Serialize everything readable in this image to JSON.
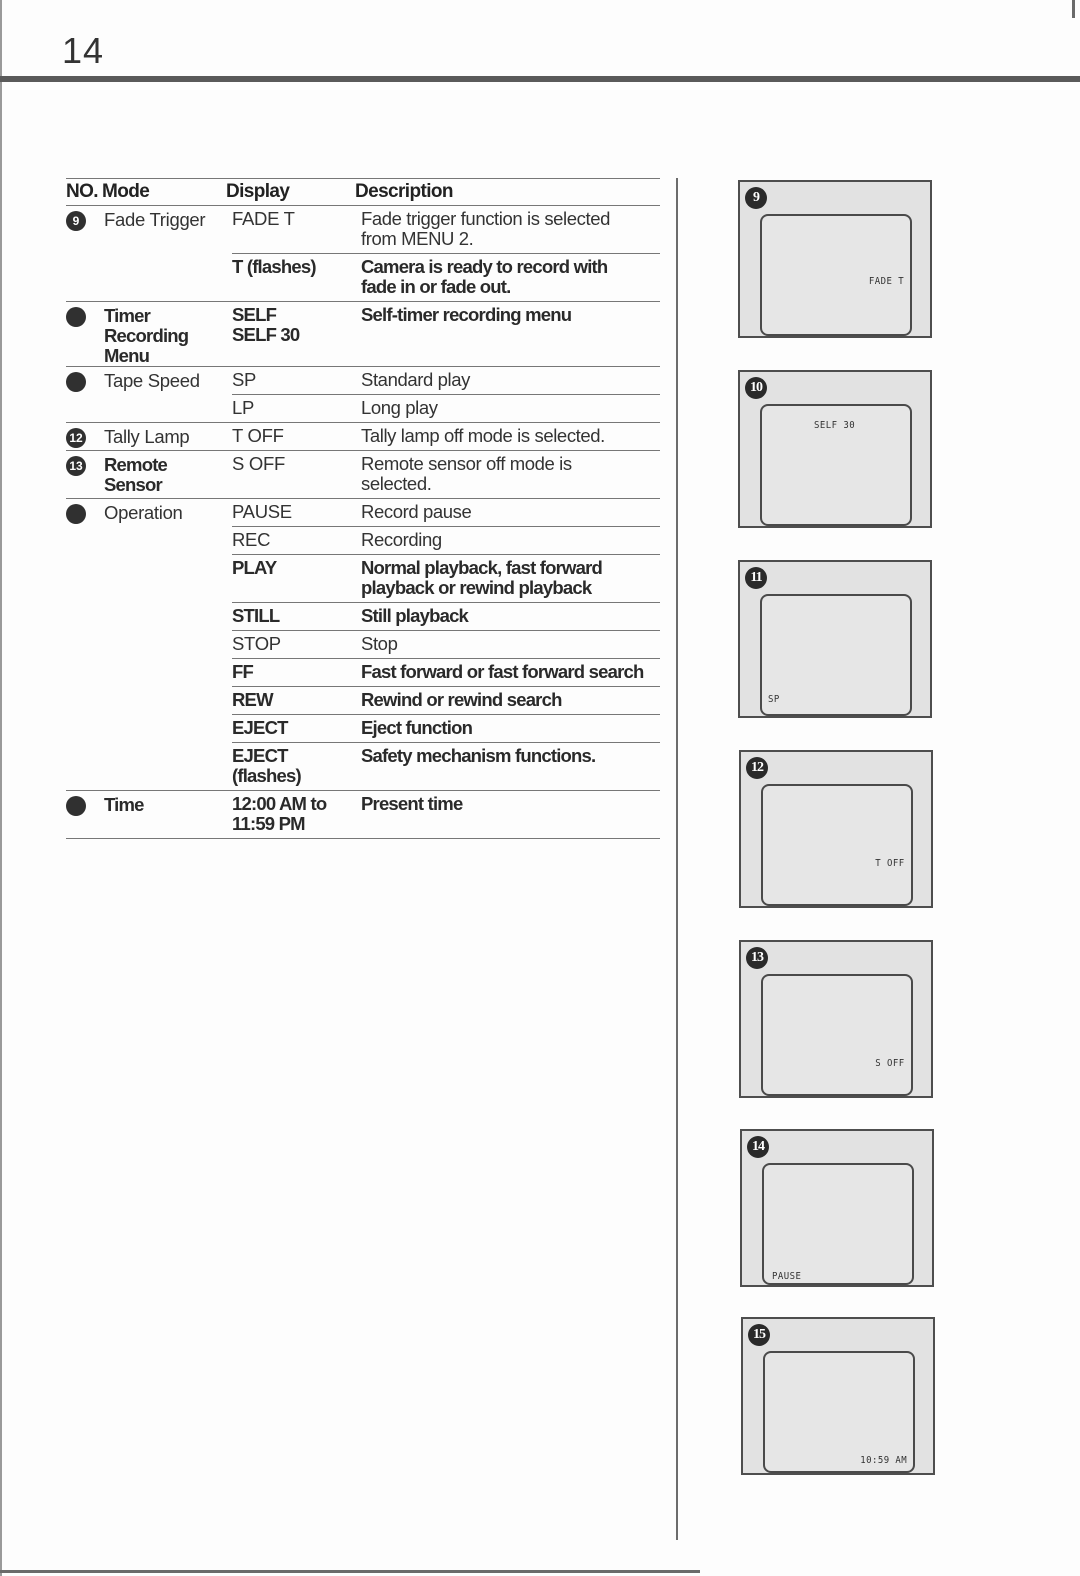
{
  "page": {
    "number": "14"
  },
  "table": {
    "headers": {
      "no": "NO.",
      "mode": "Mode",
      "display": "Display",
      "description": "Description"
    },
    "groups": [
      {
        "marker": "9",
        "mode": "Fade Trigger",
        "rows": [
          {
            "display": "FADE T",
            "description": "Fade trigger function is selected\nfrom MENU 2.",
            "bold": false
          },
          {
            "display": "T (flashes)",
            "description": "Camera is ready to record with\nfade in or fade out.",
            "bold": true
          }
        ]
      },
      {
        "marker": "",
        "mode": "Timer\nRecording\nMenu",
        "rows": [
          {
            "display": "SELF\nSELF 30",
            "description": "Self-timer recording menu",
            "bold": true
          }
        ]
      },
      {
        "marker": "",
        "mode": "Tape Speed",
        "rows": [
          {
            "display": "SP",
            "description": "Standard play",
            "bold": false
          },
          {
            "display": "LP",
            "description": "Long play",
            "bold": false
          }
        ]
      },
      {
        "marker": "12",
        "mode": "Tally Lamp",
        "rows": [
          {
            "display": "T OFF",
            "description": "Tally lamp off mode is selected.",
            "bold": false
          }
        ]
      },
      {
        "marker": "13",
        "mode": "Remote\nSensor",
        "rows": [
          {
            "display": "S OFF",
            "description": "Remote sensor off mode is\nselected.",
            "bold": false
          }
        ]
      },
      {
        "marker": "",
        "mode": "Operation",
        "rows": [
          {
            "display": "PAUSE",
            "description": "Record pause",
            "bold": false
          },
          {
            "display": "REC",
            "description": "Recording",
            "bold": false
          },
          {
            "display": "PLAY",
            "description": "Normal playback, fast forward\nplayback or rewind playback",
            "bold": true
          },
          {
            "display": "STILL",
            "description": "Still playback",
            "bold": true
          },
          {
            "display": "STOP",
            "description": "Stop",
            "bold": false
          },
          {
            "display": "FF",
            "description": "Fast forward or fast forward search",
            "bold": true
          },
          {
            "display": "REW",
            "description": "Rewind or rewind search",
            "bold": true
          },
          {
            "display": "EJECT",
            "description": "Eject function",
            "bold": true
          },
          {
            "display": "EJECT\n(flashes)",
            "description": "Safety mechanism functions.",
            "bold": true
          }
        ]
      },
      {
        "marker": "",
        "mode": "Time",
        "rows": [
          {
            "display": "12:00 AM to\n11:59 PM",
            "description": "Present time",
            "bold": true
          }
        ]
      }
    ]
  },
  "screens": [
    {
      "badge": "9",
      "osd": "FADE T"
    },
    {
      "badge": "10",
      "osd": "SELF 30"
    },
    {
      "badge": "11",
      "osd": "SP"
    },
    {
      "badge": "12",
      "osd": "T OFF"
    },
    {
      "badge": "13",
      "osd": "S OFF"
    },
    {
      "badge": "14",
      "osd": "PAUSE"
    },
    {
      "badge": "15",
      "osd": "10:59 AM"
    }
  ]
}
